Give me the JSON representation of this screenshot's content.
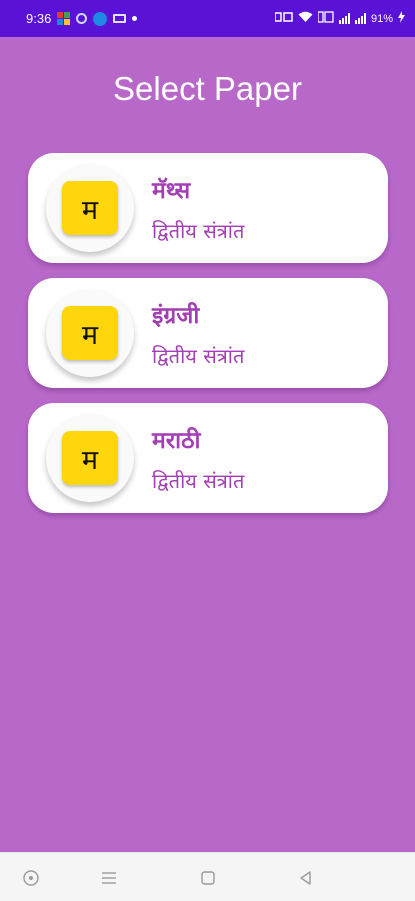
{
  "status_bar": {
    "time": "9:36",
    "battery": "91%"
  },
  "header": {
    "title": "Select Paper"
  },
  "papers": [
    {
      "icon_letter": "म",
      "title": "मॅथ्स",
      "subtitle": "द्वितीय संत्रांत"
    },
    {
      "icon_letter": "म",
      "title": "इंग्रजी",
      "subtitle": "द्वितीय संत्रांत"
    },
    {
      "icon_letter": "म",
      "title": "मराठी",
      "subtitle": "द्वितीय संत्रांत"
    }
  ],
  "nav": {
    "buttons": [
      "accessibility-icon",
      "menu-icon",
      "home-square-icon",
      "back-triangle-icon"
    ]
  },
  "colors": {
    "background": "#B868C8",
    "status_bar": "#5A12D6",
    "accent_text": "#A33FB4",
    "icon_yellow": "#FFD50C",
    "card": "#FFFFFF"
  }
}
